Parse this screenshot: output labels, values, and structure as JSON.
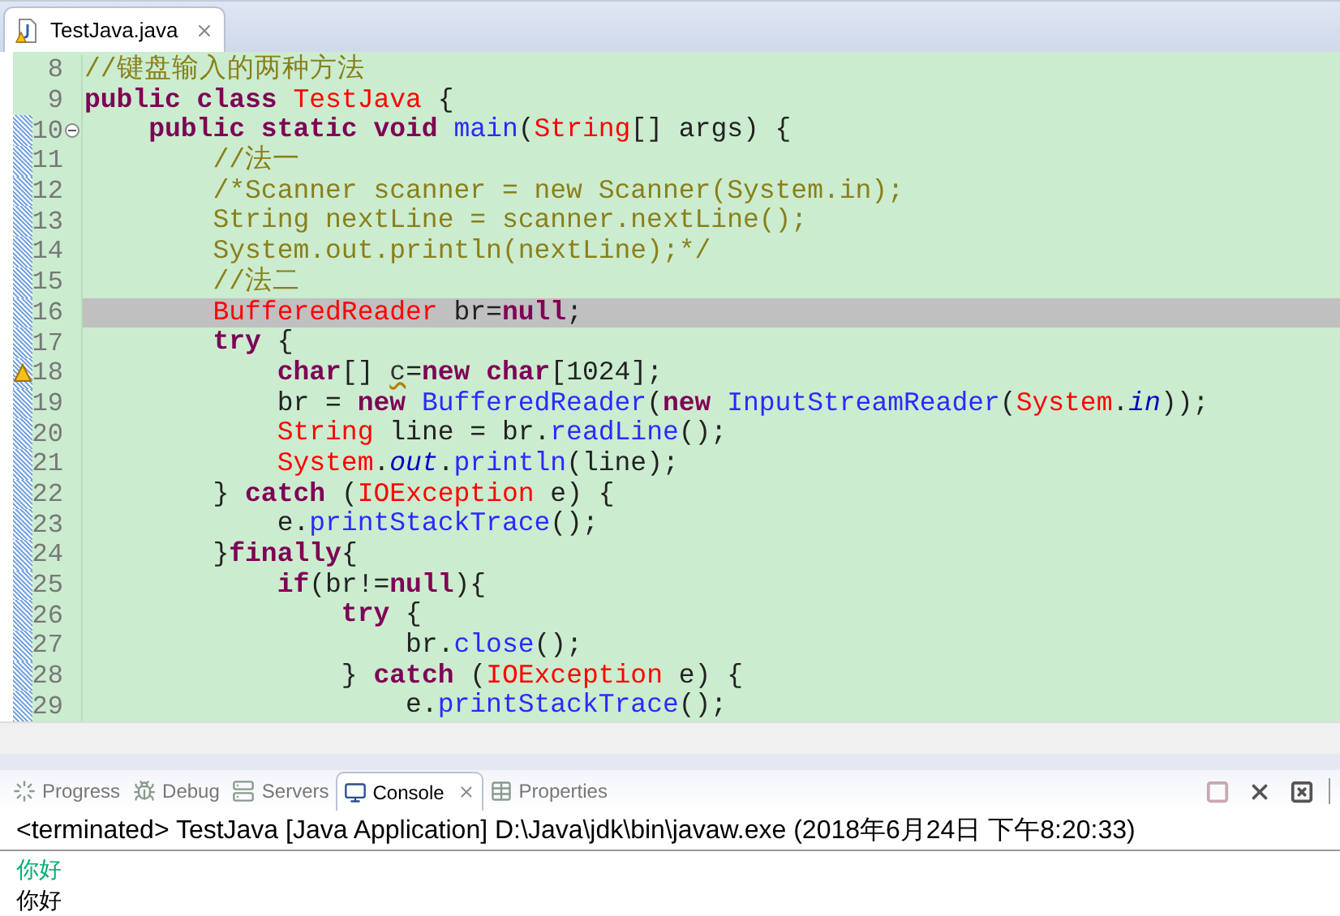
{
  "editor": {
    "tab": {
      "title": "TestJava.java",
      "selected": true
    },
    "lines": [
      {
        "number": "8",
        "current": false,
        "marked": false,
        "fold_control": false,
        "warning": false,
        "tokens": [
          {
            "kind": "comment",
            "text": "//键盘输入的两种方法"
          }
        ]
      },
      {
        "number": "9",
        "current": false,
        "marked": false,
        "fold_control": false,
        "warning": false,
        "tokens": [
          {
            "kind": "keyword",
            "text": "public class "
          },
          {
            "kind": "type",
            "text": "TestJava"
          },
          {
            "kind": "plain",
            "text": " {"
          }
        ]
      },
      {
        "number": "10",
        "current": false,
        "marked": true,
        "fold_control": true,
        "warning": false,
        "tokens": [
          {
            "kind": "keyword",
            "text": "    public static void "
          },
          {
            "kind": "method",
            "text": "main"
          },
          {
            "kind": "plain",
            "text": "("
          },
          {
            "kind": "type",
            "text": "String"
          },
          {
            "kind": "plain",
            "text": "[] args) {"
          }
        ]
      },
      {
        "number": "11",
        "current": false,
        "marked": true,
        "fold_control": false,
        "warning": false,
        "tokens": [
          {
            "kind": "comment",
            "text": "        //法一"
          }
        ]
      },
      {
        "number": "12",
        "current": false,
        "marked": true,
        "fold_control": false,
        "warning": false,
        "tokens": [
          {
            "kind": "comment",
            "text": "        /*Scanner scanner = new Scanner(System.in);"
          }
        ]
      },
      {
        "number": "13",
        "current": false,
        "marked": true,
        "fold_control": false,
        "warning": false,
        "tokens": [
          {
            "kind": "comment",
            "text": "        String nextLine = scanner.nextLine();"
          }
        ]
      },
      {
        "number": "14",
        "current": false,
        "marked": true,
        "fold_control": false,
        "warning": false,
        "tokens": [
          {
            "kind": "comment",
            "text": "        System.out.println(nextLine);*/"
          }
        ]
      },
      {
        "number": "15",
        "current": false,
        "marked": true,
        "fold_control": false,
        "warning": false,
        "tokens": [
          {
            "kind": "comment",
            "text": "        //法二"
          }
        ]
      },
      {
        "number": "16",
        "current": true,
        "marked": true,
        "fold_control": false,
        "warning": false,
        "tokens": [
          {
            "kind": "type",
            "text": "        BufferedReader"
          },
          {
            "kind": "plain",
            "text": " br="
          },
          {
            "kind": "keyword",
            "text": "null"
          },
          {
            "kind": "plain",
            "text": ";"
          }
        ]
      },
      {
        "number": "17",
        "current": false,
        "marked": true,
        "fold_control": false,
        "warning": false,
        "tokens": [
          {
            "kind": "keyword",
            "text": "        try"
          },
          {
            "kind": "plain",
            "text": " {"
          }
        ]
      },
      {
        "number": "18",
        "current": false,
        "marked": true,
        "fold_control": false,
        "warning": true,
        "tokens": [
          {
            "kind": "keyword",
            "text": "            char"
          },
          {
            "kind": "plain",
            "text": "[] "
          },
          {
            "kind": "warning",
            "text": "c"
          },
          {
            "kind": "plain",
            "text": "="
          },
          {
            "kind": "keyword",
            "text": "new char"
          },
          {
            "kind": "plain",
            "text": "[1024];"
          }
        ]
      },
      {
        "number": "19",
        "current": false,
        "marked": true,
        "fold_control": false,
        "warning": false,
        "tokens": [
          {
            "kind": "plain",
            "text": "            br = "
          },
          {
            "kind": "keyword",
            "text": "new "
          },
          {
            "kind": "method",
            "text": "BufferedReader"
          },
          {
            "kind": "plain",
            "text": "("
          },
          {
            "kind": "keyword",
            "text": "new "
          },
          {
            "kind": "method",
            "text": "InputStreamReader"
          },
          {
            "kind": "plain",
            "text": "("
          },
          {
            "kind": "type",
            "text": "System"
          },
          {
            "kind": "plain",
            "text": "."
          },
          {
            "kind": "static",
            "text": "in"
          },
          {
            "kind": "plain",
            "text": "));"
          }
        ]
      },
      {
        "number": "20",
        "current": false,
        "marked": true,
        "fold_control": false,
        "warning": false,
        "tokens": [
          {
            "kind": "type",
            "text": "            String"
          },
          {
            "kind": "plain",
            "text": " line = br."
          },
          {
            "kind": "method",
            "text": "readLine"
          },
          {
            "kind": "plain",
            "text": "();"
          }
        ]
      },
      {
        "number": "21",
        "current": false,
        "marked": true,
        "fold_control": false,
        "warning": false,
        "tokens": [
          {
            "kind": "type",
            "text": "            System"
          },
          {
            "kind": "plain",
            "text": "."
          },
          {
            "kind": "static",
            "text": "out"
          },
          {
            "kind": "plain",
            "text": "."
          },
          {
            "kind": "method",
            "text": "println"
          },
          {
            "kind": "plain",
            "text": "(line);"
          }
        ]
      },
      {
        "number": "22",
        "current": false,
        "marked": true,
        "fold_control": false,
        "warning": false,
        "tokens": [
          {
            "kind": "plain",
            "text": "        } "
          },
          {
            "kind": "keyword",
            "text": "catch"
          },
          {
            "kind": "plain",
            "text": " ("
          },
          {
            "kind": "type",
            "text": "IOException"
          },
          {
            "kind": "plain",
            "text": " e) {"
          }
        ]
      },
      {
        "number": "23",
        "current": false,
        "marked": true,
        "fold_control": false,
        "warning": false,
        "tokens": [
          {
            "kind": "plain",
            "text": "            e."
          },
          {
            "kind": "method",
            "text": "printStackTrace"
          },
          {
            "kind": "plain",
            "text": "();"
          }
        ]
      },
      {
        "number": "24",
        "current": false,
        "marked": true,
        "fold_control": false,
        "warning": false,
        "tokens": [
          {
            "kind": "plain",
            "text": "        }"
          },
          {
            "kind": "keyword",
            "text": "finally"
          },
          {
            "kind": "plain",
            "text": "{"
          }
        ]
      },
      {
        "number": "25",
        "current": false,
        "marked": true,
        "fold_control": false,
        "warning": false,
        "tokens": [
          {
            "kind": "keyword",
            "text": "            if"
          },
          {
            "kind": "plain",
            "text": "(br!="
          },
          {
            "kind": "keyword",
            "text": "null"
          },
          {
            "kind": "plain",
            "text": "){"
          }
        ]
      },
      {
        "number": "26",
        "current": false,
        "marked": true,
        "fold_control": false,
        "warning": false,
        "tokens": [
          {
            "kind": "keyword",
            "text": "                try"
          },
          {
            "kind": "plain",
            "text": " {"
          }
        ]
      },
      {
        "number": "27",
        "current": false,
        "marked": true,
        "fold_control": false,
        "warning": false,
        "tokens": [
          {
            "kind": "plain",
            "text": "                    br."
          },
          {
            "kind": "method",
            "text": "close"
          },
          {
            "kind": "plain",
            "text": "();"
          }
        ]
      },
      {
        "number": "28",
        "current": false,
        "marked": true,
        "fold_control": false,
        "warning": false,
        "tokens": [
          {
            "kind": "plain",
            "text": "                } "
          },
          {
            "kind": "keyword",
            "text": "catch"
          },
          {
            "kind": "plain",
            "text": " ("
          },
          {
            "kind": "type",
            "text": "IOException"
          },
          {
            "kind": "plain",
            "text": " e) {"
          }
        ]
      },
      {
        "number": "29",
        "current": false,
        "marked": true,
        "fold_control": false,
        "warning": false,
        "tokens": [
          {
            "kind": "plain",
            "text": "                    e."
          },
          {
            "kind": "method",
            "text": "printStackTrace"
          },
          {
            "kind": "plain",
            "text": "();"
          }
        ]
      }
    ]
  },
  "panel": {
    "tabs": [
      {
        "kind": "progress",
        "label": "Progress",
        "selected": false
      },
      {
        "kind": "debug",
        "label": "Debug",
        "selected": false
      },
      {
        "kind": "servers",
        "label": "Servers",
        "selected": false
      },
      {
        "kind": "console",
        "label": "Console",
        "selected": true
      },
      {
        "kind": "properties",
        "label": "Properties",
        "selected": false
      }
    ],
    "toolbar": [
      {
        "kind": "terminate",
        "disabled": true
      },
      {
        "kind": "remove",
        "disabled": false
      },
      {
        "kind": "remove_all",
        "disabled": false
      }
    ],
    "console": {
      "header": "<terminated> TestJava [Java Application] D:\\Java\\jdk\\bin\\javaw.exe (2018年6月24日 下午8:20:33)",
      "output": [
        {
          "kind": "input",
          "text": "你好"
        },
        {
          "kind": "output",
          "text": "你好"
        }
      ]
    }
  }
}
